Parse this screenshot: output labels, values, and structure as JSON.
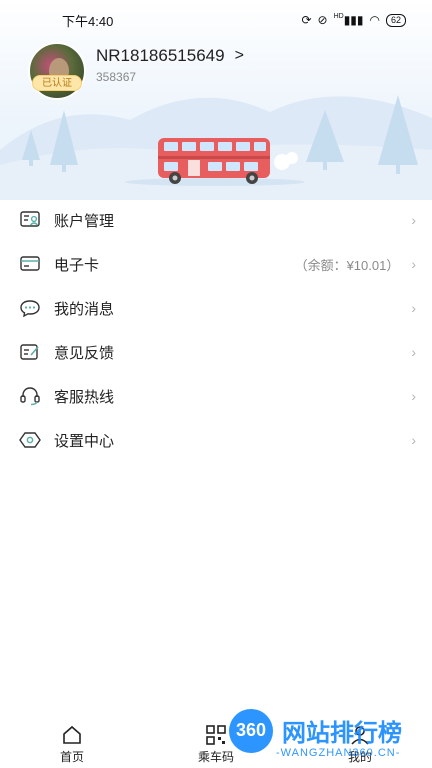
{
  "status_bar": {
    "time": "下午4:40",
    "network": "HD",
    "battery": "62"
  },
  "profile": {
    "username": "NR18186515649",
    "chevron": ">",
    "user_id": "358367",
    "verified_label": "已认证"
  },
  "menu": {
    "items": [
      {
        "label": "账户管理",
        "icon": "account-card-icon",
        "extra": ""
      },
      {
        "label": "电子卡",
        "icon": "card-icon",
        "extra": "（余额：¥10.01）"
      },
      {
        "label": "我的消息",
        "icon": "message-icon",
        "extra": ""
      },
      {
        "label": "意见反馈",
        "icon": "feedback-icon",
        "extra": ""
      },
      {
        "label": "客服热线",
        "icon": "headset-icon",
        "extra": ""
      },
      {
        "label": "设置中心",
        "icon": "settings-icon",
        "extra": ""
      }
    ],
    "chevron": "›"
  },
  "bottom_nav": {
    "items": [
      {
        "label": "首页",
        "icon": "home-icon"
      },
      {
        "label": "乘车码",
        "icon": "qr-code-icon"
      },
      {
        "label": "我的",
        "icon": "user-icon"
      }
    ]
  },
  "watermark": {
    "number": "360",
    "title": "网站排行榜",
    "url": "-WANGZHAN360.CN-"
  },
  "colors": {
    "accent": "#5bb0a8",
    "bus": "#e85d5d",
    "sky": "#eef5fc",
    "tree": "#c6dcef"
  }
}
